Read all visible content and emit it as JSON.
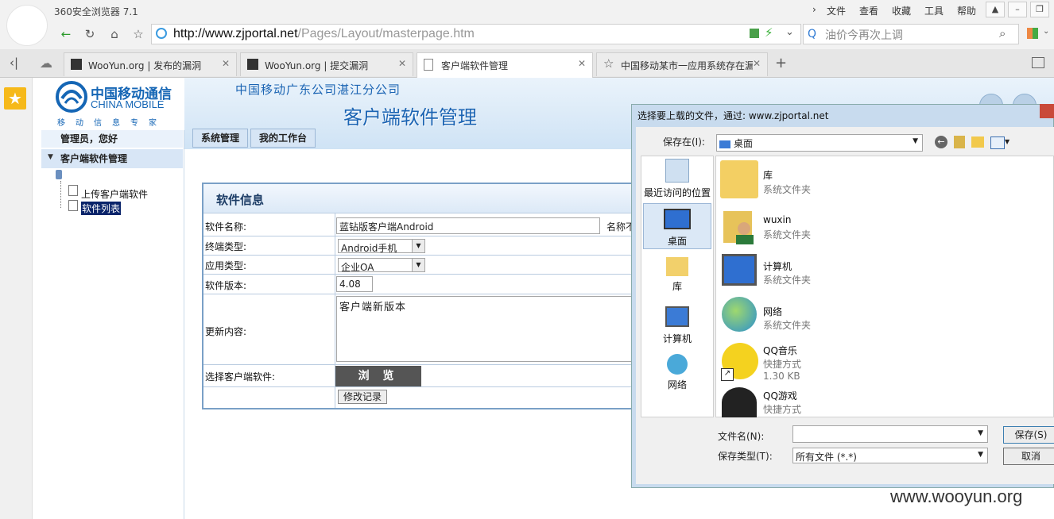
{
  "browser": {
    "app_title": "360安全浏览器 7.1",
    "menu": [
      "文件",
      "查看",
      "收藏",
      "工具",
      "帮助"
    ],
    "url_host": "http://www.zjportal.net",
    "url_path": "/Pages/Layout/masterpage.htm",
    "search_placeholder": "油价今再次上调",
    "tabs": [
      {
        "title": "WooYun.org | 发布的漏洞",
        "active": false
      },
      {
        "title": "WooYun.org | 提交漏洞",
        "active": false
      },
      {
        "title": "客户端软件管理",
        "active": true
      },
      {
        "title": "中国移动某市一应用系统存在漏",
        "active": false
      }
    ],
    "new_tab": "+"
  },
  "page": {
    "logo_cn": "中国移动通信",
    "logo_en": "CHINA MOBILE",
    "logo_slogan": "移动信息专家",
    "branch": "中国移动广东公司湛江分公司",
    "title": "客户端软件管理",
    "greeting": "管理员，您好",
    "top_tabs": [
      "系统管理",
      "我的工作台"
    ],
    "tree": {
      "root": "客户端软件管理",
      "items": [
        "上传客户端软件",
        "软件列表"
      ]
    },
    "form": {
      "heading": "软件信息",
      "name_label": "软件名称:",
      "name_value": "蓝钻版客户端Android",
      "name_hint": "名称不",
      "terminal_label": "终端类型:",
      "terminal_value": "Android手机",
      "app_label": "应用类型:",
      "app_value": "企业OA",
      "version_label": "软件版本:",
      "version_value": "4.08",
      "update_label": "更新内容:",
      "update_value": "客户端新版本",
      "file_label": "选择客户端软件:",
      "browse_label": "浏 览",
      "history_label": "修改记录"
    }
  },
  "dialog": {
    "title": "选择要上载的文件，通过: www.zjportal.net",
    "save_in_label": "保存在(I):",
    "save_in_value": "桌面",
    "places": [
      "最近访问的位置",
      "桌面",
      "库",
      "计算机",
      "网络"
    ],
    "files": [
      {
        "name": "库",
        "sub": "系统文件夹",
        "size": ""
      },
      {
        "name": "wuxin",
        "sub": "系统文件夹",
        "size": ""
      },
      {
        "name": "计算机",
        "sub": "系统文件夹",
        "size": ""
      },
      {
        "name": "网络",
        "sub": "系统文件夹",
        "size": ""
      },
      {
        "name": "QQ音乐",
        "sub": "快捷方式",
        "size": "1.30 KB"
      },
      {
        "name": "QQ游戏",
        "sub": "快捷方式",
        "size": ""
      }
    ],
    "file_name_label": "文件名(N):",
    "file_name_value": "",
    "file_type_label": "保存类型(T):",
    "file_type_value": "所有文件 (*.*)",
    "save_button": "保存(S)",
    "cancel_button": "取消"
  },
  "watermark": "www.wooyun.org"
}
